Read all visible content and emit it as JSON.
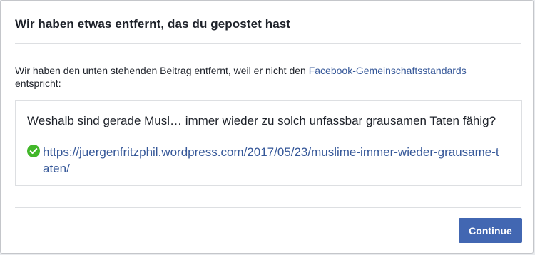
{
  "dialog": {
    "title": "Wir haben etwas entfernt, das du gepostet hast",
    "message_before": "Wir haben den unten stehenden Beitrag entfernt, weil er nicht den ",
    "message_link": "Facebook-Gemeinschaftsstandards",
    "message_after": " entspricht:",
    "post": {
      "text": "Weshalb sind gerade Musl… immer wieder zu solch unfassbar grausamen Taten fähig?",
      "link": "https://juergenfritzphil.wordpress.com/2017/05/23/muslime-immer-wieder-grausame-taten/",
      "link_icon": "green-check-icon"
    },
    "continue_label": "Continue"
  },
  "colors": {
    "link": "#365899",
    "button": "#4267b2",
    "check": "#42b72a"
  }
}
